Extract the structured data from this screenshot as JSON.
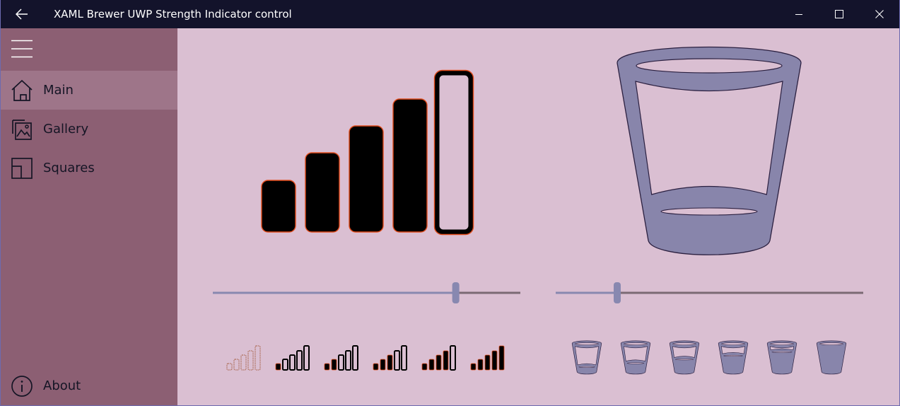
{
  "window": {
    "title": "XAML Brewer UWP Strength Indicator control",
    "titlebar_bg": "#13132b"
  },
  "sidebar": {
    "bg": "#8c5f73",
    "selected_bg": "#9e7589",
    "items": [
      {
        "label": "Main",
        "icon": "home-icon",
        "selected": true
      },
      {
        "label": "Gallery",
        "icon": "gallery-icon",
        "selected": false
      },
      {
        "label": "Squares",
        "icon": "squares-icon",
        "selected": false
      }
    ],
    "footer": {
      "label": "About",
      "icon": "info-icon"
    }
  },
  "main": {
    "bg": "#dabfd2",
    "signal": {
      "fill": "#000000",
      "stroke": "#e04a1a",
      "bar_count": 5,
      "value": 4,
      "slider_fraction": 0.79,
      "slider_color": "#8888b0",
      "track_color": "#7b6a74",
      "thumbnails": [
        0,
        1,
        2,
        3,
        4,
        5
      ]
    },
    "bucket": {
      "fill": "#8885ab",
      "outline": "#2b2040",
      "slider_fraction": 0.2,
      "thumbnails": [
        0,
        1,
        2,
        3,
        4,
        5
      ]
    }
  }
}
